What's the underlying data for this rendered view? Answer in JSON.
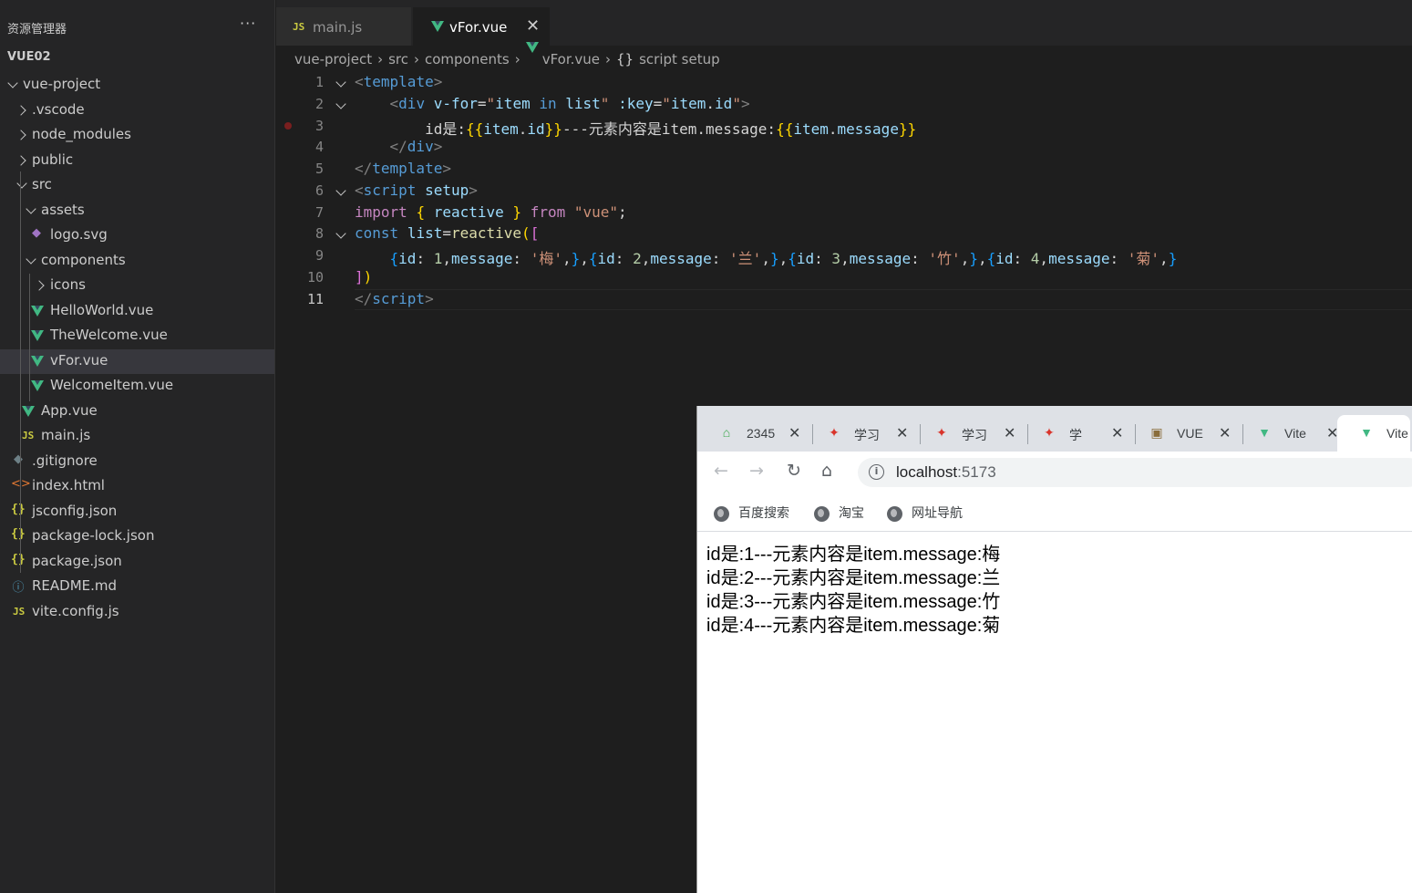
{
  "explorer": {
    "title": "资源管理器",
    "more": "···",
    "root": "VUE02",
    "items": [
      {
        "label": "vue-project",
        "depth": 0,
        "kind": "folder-open"
      },
      {
        "label": ".vscode",
        "depth": 1,
        "kind": "folder"
      },
      {
        "label": "node_modules",
        "depth": 1,
        "kind": "folder"
      },
      {
        "label": "public",
        "depth": 1,
        "kind": "folder"
      },
      {
        "label": "src",
        "depth": 1,
        "kind": "folder-open"
      },
      {
        "label": "assets",
        "depth": 2,
        "kind": "folder-open"
      },
      {
        "label": "logo.svg",
        "depth": 3,
        "kind": "svg"
      },
      {
        "label": "components",
        "depth": 2,
        "kind": "folder-open"
      },
      {
        "label": "icons",
        "depth": 3,
        "kind": "folder"
      },
      {
        "label": "HelloWorld.vue",
        "depth": 3,
        "kind": "vue"
      },
      {
        "label": "TheWelcome.vue",
        "depth": 3,
        "kind": "vue"
      },
      {
        "label": "vFor.vue",
        "depth": 3,
        "kind": "vue",
        "selected": true
      },
      {
        "label": "WelcomeItem.vue",
        "depth": 3,
        "kind": "vue"
      },
      {
        "label": "App.vue",
        "depth": 2,
        "kind": "vue"
      },
      {
        "label": "main.js",
        "depth": 2,
        "kind": "js"
      },
      {
        "label": ".gitignore",
        "depth": 1,
        "kind": "git"
      },
      {
        "label": "index.html",
        "depth": 1,
        "kind": "html"
      },
      {
        "label": "jsconfig.json",
        "depth": 1,
        "kind": "json"
      },
      {
        "label": "package-lock.json",
        "depth": 1,
        "kind": "json"
      },
      {
        "label": "package.json",
        "depth": 1,
        "kind": "json"
      },
      {
        "label": "README.md",
        "depth": 1,
        "kind": "info"
      },
      {
        "label": "vite.config.js",
        "depth": 1,
        "kind": "js"
      }
    ]
  },
  "tabs": [
    {
      "label": "main.js",
      "icon": "js-icon",
      "active": false
    },
    {
      "label": "vFor.vue",
      "icon": "vue-icon",
      "active": true
    }
  ],
  "breadcrumb": [
    "vue-project",
    "src",
    "components",
    "vFor.vue",
    "script setup"
  ],
  "breadcrumb_symbol": "{}",
  "editor": {
    "line_numbers": [
      "1",
      "2",
      "3",
      "4",
      "5",
      "6",
      "7",
      "8",
      "9",
      "10",
      "11"
    ],
    "current_line": "11"
  },
  "browser": {
    "tabs": [
      {
        "label": "2345",
        "favicon": "2345-icon"
      },
      {
        "label": "学习",
        "favicon": "study-icon"
      },
      {
        "label": "学习",
        "favicon": "study-icon"
      },
      {
        "label": "学",
        "favicon": "study-icon"
      },
      {
        "label": "VUE",
        "favicon": "vue-image-icon"
      },
      {
        "label": "Vite",
        "favicon": "vite-icon"
      },
      {
        "label": "Vite",
        "favicon": "vite-icon",
        "active": true
      }
    ],
    "url_host": "localhost",
    "url_port": ":5173",
    "bookmarks": [
      "百度搜索",
      "淘宝",
      "网址导航"
    ],
    "content_lines": [
      "id是:1---元素内容是item.message:梅",
      "id是:2---元素内容是item.message:兰",
      "id是:3---元素内容是item.message:竹",
      "id是:4---元素内容是item.message:菊"
    ]
  },
  "colors": {
    "vue_green": "#41b883",
    "js_yellow": "#cbcb41",
    "editor_bg": "#1e1e1e",
    "sidebar_bg": "#252526"
  }
}
